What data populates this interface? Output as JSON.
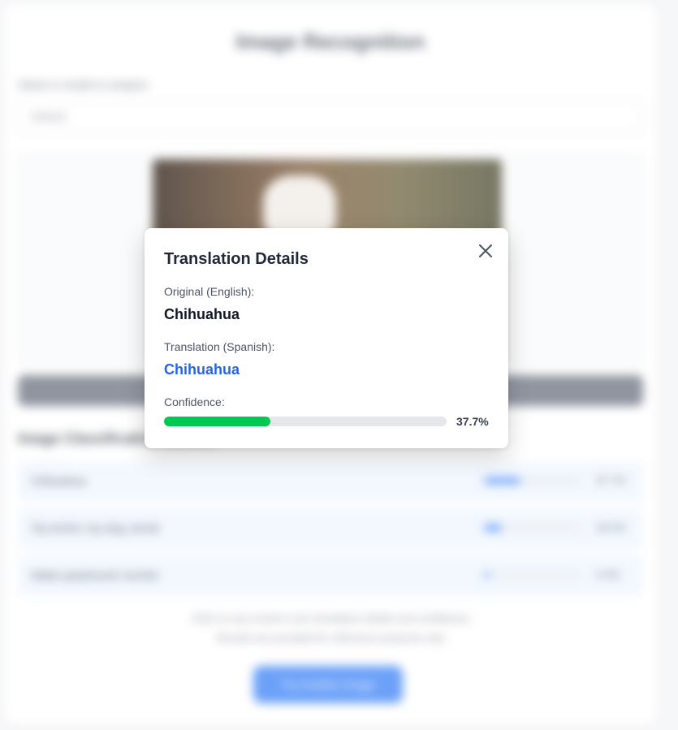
{
  "background": {
    "title": "Image Recognition",
    "select_label": "Select a model to analyze",
    "select_value": "Default",
    "analyze_button": "Analyze Image",
    "results_title": "Image Classification Results",
    "results": [
      {
        "label": "Chihuahua",
        "pct": "37.7%",
        "value": 0.377
      },
      {
        "label": "Toy terrier, toy dog, terrier",
        "pct": "18.2%",
        "value": 0.182
      },
      {
        "label": "Italian greyhound, lurcher",
        "pct": "5.4%",
        "value": 0.054
      }
    ],
    "note_line1": "Click on any result to see translation details and confidence",
    "note_line2": "Results are provided for reference purposes only",
    "cta_button": "Try Another Image"
  },
  "modal": {
    "title": "Translation Details",
    "original_label": "Original (English):",
    "original_value": "Chihuahua",
    "translation_label": "Translation (Spanish):",
    "translation_value": "Chihuahua",
    "confidence_label": "Confidence:",
    "confidence_value": 0.377,
    "confidence_text": "37.7%"
  },
  "colors": {
    "accent": "#2563eb",
    "confidence_fill": "#00c853",
    "track": "#e5e7eb"
  },
  "icons": {
    "close": "close-icon"
  }
}
